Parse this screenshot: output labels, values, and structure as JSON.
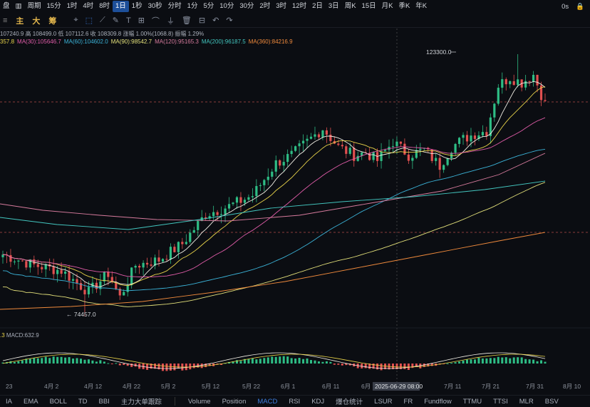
{
  "toolbar": {
    "left_label": "盘",
    "chart_icon": "candles-icon",
    "period_label": "周期",
    "intervals": [
      "15分",
      "1时",
      "4时",
      "8时",
      "1日",
      "1秒",
      "30秒",
      "分时",
      "1分",
      "5分",
      "10分",
      "30分",
      "2时",
      "3时",
      "12时",
      "2日",
      "3日",
      "周K",
      "15日",
      "月K",
      "季K",
      "年K"
    ],
    "active_interval": "1日",
    "time_display": "0s"
  },
  "toolbar2": {
    "labels": [
      "主",
      "大",
      "筹"
    ]
  },
  "info": {
    "ohlc": "107240.9 高 108499.0 低 107112.6 收 108309.8 涨幅 1.00%(1068.8) 振幅 1.29%",
    "ma": [
      {
        "text": "357.8",
        "color": "#e8d34a"
      },
      {
        "text": "MA(30):105646.7",
        "color": "#e05ca8"
      },
      {
        "text": "MA(60):104602.0",
        "color": "#3bb3d8"
      },
      {
        "text": "MA(90):98542.7",
        "color": "#e3e07a"
      },
      {
        "text": "MA(120):95165.3",
        "color": "#d77b9d"
      },
      {
        "text": "MA(200):96187.5",
        "color": "#43c7c0"
      },
      {
        "text": "MA(360):84216.9",
        "color": "#f08a3c"
      }
    ]
  },
  "macd": {
    "label": "MACD:632.9",
    "prefix": ".3"
  },
  "chart_data": {
    "type": "candlestick",
    "annotations": {
      "high": "123300.0",
      "low": "74457.0"
    },
    "x_tick_labels": [
      "23",
      "4月 2",
      "4月 12",
      "4月 22",
      "5月 2",
      "5月 12",
      "5月 22",
      "6月 1",
      "6月 11",
      "6月 2",
      "7月 11",
      "7月 21",
      "7月 31",
      "8月 10"
    ],
    "crosshair_label": "2025-06-29 08:00"
  },
  "bottom_tabs": [
    "IA",
    "EMA",
    "BOLL",
    "TD",
    "BBI",
    "主力大单跟踪",
    "Volume",
    "Position",
    "MACD",
    "RSI",
    "KDJ",
    "爆仓统计",
    "LSUR",
    "FR",
    "Fundflow",
    "TTMU",
    "TTSI",
    "MLR",
    "BSV"
  ],
  "active_tab": "MACD"
}
